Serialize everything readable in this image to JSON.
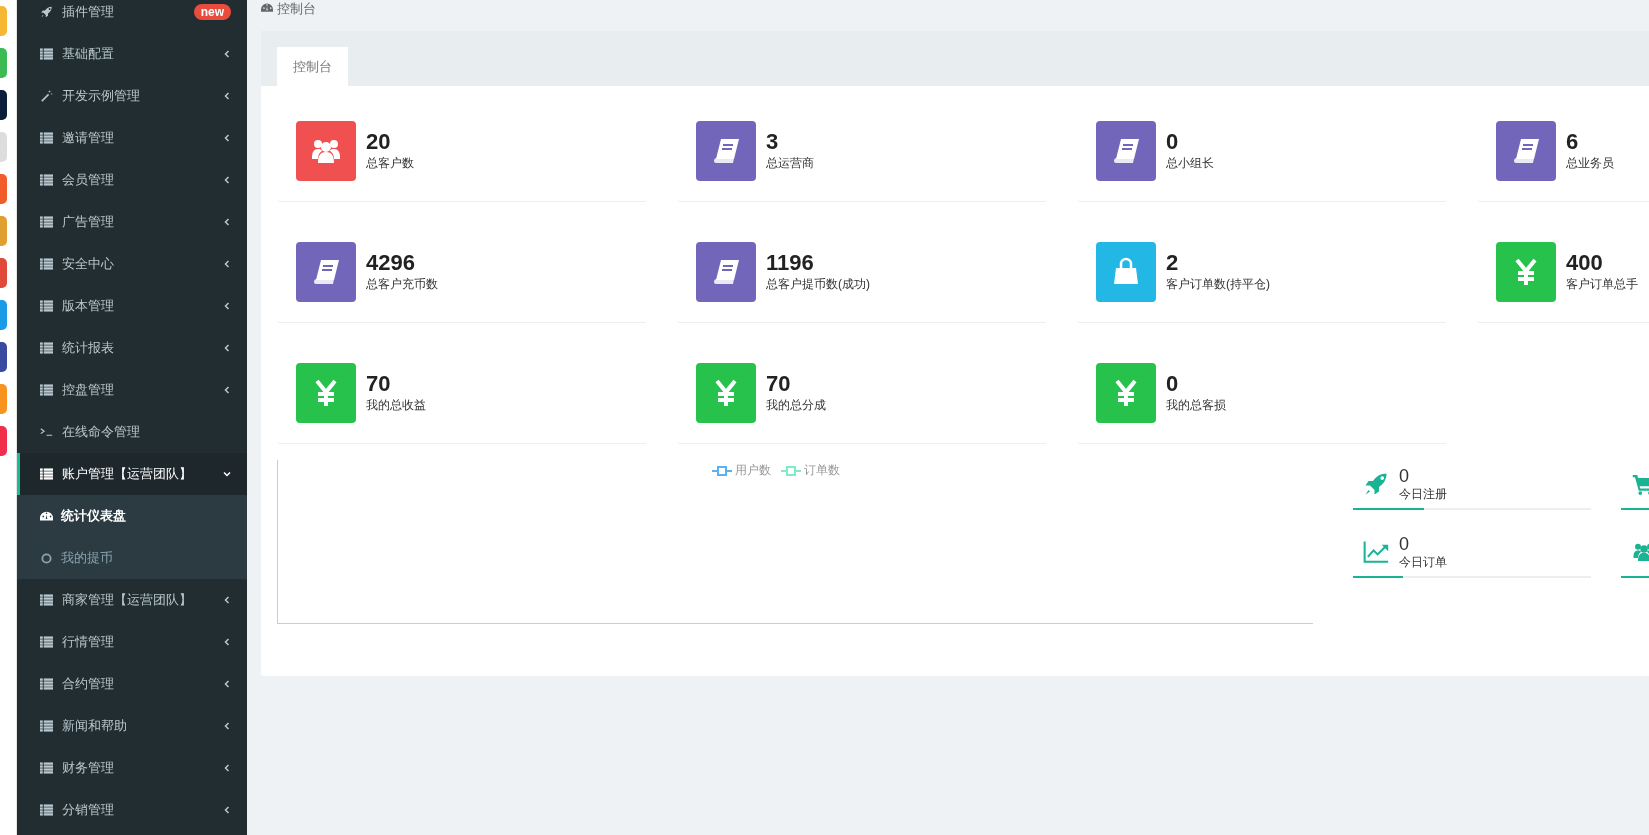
{
  "sidebar": {
    "items": [
      {
        "label": "插件管理",
        "kind": "rocket",
        "badge": "new",
        "expanded": false
      },
      {
        "label": "基础配置",
        "kind": "list",
        "expanded": false
      },
      {
        "label": "开发示例管理",
        "kind": "wand",
        "expanded": false
      },
      {
        "label": "邀请管理",
        "kind": "list",
        "expanded": false
      },
      {
        "label": "会员管理",
        "kind": "list",
        "expanded": false
      },
      {
        "label": "广告管理",
        "kind": "list",
        "expanded": false
      },
      {
        "label": "安全中心",
        "kind": "list",
        "expanded": false
      },
      {
        "label": "版本管理",
        "kind": "list",
        "expanded": false
      },
      {
        "label": "统计报表",
        "kind": "list",
        "expanded": false
      },
      {
        "label": "控盘管理",
        "kind": "list",
        "expanded": false
      },
      {
        "label": "在线命令管理",
        "kind": "terminal"
      },
      {
        "label": "账户管理【运营团队】",
        "kind": "list",
        "expanded": true,
        "children": [
          {
            "label": "统计仪表盘",
            "kind": "gauge",
            "selected": true
          },
          {
            "label": "我的提币",
            "kind": "circle",
            "selected": false
          }
        ]
      },
      {
        "label": "商家管理【运营团队】",
        "kind": "list",
        "expanded": false
      },
      {
        "label": "行情管理",
        "kind": "list",
        "expanded": false
      },
      {
        "label": "合约管理",
        "kind": "list",
        "expanded": false
      },
      {
        "label": "新闻和帮助",
        "kind": "list",
        "expanded": false
      },
      {
        "label": "财务管理",
        "kind": "list",
        "expanded": false
      },
      {
        "label": "分销管理",
        "kind": "list",
        "expanded": false
      }
    ]
  },
  "breadcrumb": "控制台",
  "tabs": [
    {
      "label": "控制台",
      "selected": true
    }
  ],
  "stat_cards": [
    {
      "value": "20",
      "label": "总客户数",
      "kind": "users",
      "color": "#f05050"
    },
    {
      "value": "3",
      "label": "总运营商",
      "kind": "book",
      "color": "#7266ba"
    },
    {
      "value": "0",
      "label": "总小组长",
      "kind": "book",
      "color": "#7266ba"
    },
    {
      "value": "6",
      "label": "总业务员",
      "kind": "book",
      "color": "#7266ba"
    },
    {
      "value": "4296",
      "label": "总客户充币数",
      "kind": "book",
      "color": "#7266ba"
    },
    {
      "value": "1196",
      "label": "总客户提币数(成功)",
      "kind": "book",
      "color": "#7266ba"
    },
    {
      "value": "2",
      "label": "客户订单数(持平仓)",
      "kind": "bag",
      "color": "#23b7e5"
    },
    {
      "value": "400",
      "label": "客户订单总手",
      "kind": "yen",
      "color": "#27c24c"
    },
    {
      "value": "70",
      "label": "我的总收益",
      "kind": "yen",
      "color": "#27c24c"
    },
    {
      "value": "70",
      "label": "我的总分成",
      "kind": "yen",
      "color": "#27c24c"
    },
    {
      "value": "0",
      "label": "我的总客损",
      "kind": "yen",
      "color": "#27c24c"
    }
  ],
  "chart": {
    "legend": [
      {
        "label": "用户数",
        "color": "#5ab1ef"
      },
      {
        "label": "订单数",
        "color": "#7eecc4"
      }
    ]
  },
  "today_stats": [
    {
      "kind": "rocket",
      "value": "0",
      "label": "今日注册",
      "level": 0.3
    },
    {
      "kind": "cart"
    },
    {
      "kind": "chart",
      "value": "0",
      "label": "今日订单",
      "level": 0.21
    },
    {
      "kind": "users"
    }
  ]
}
